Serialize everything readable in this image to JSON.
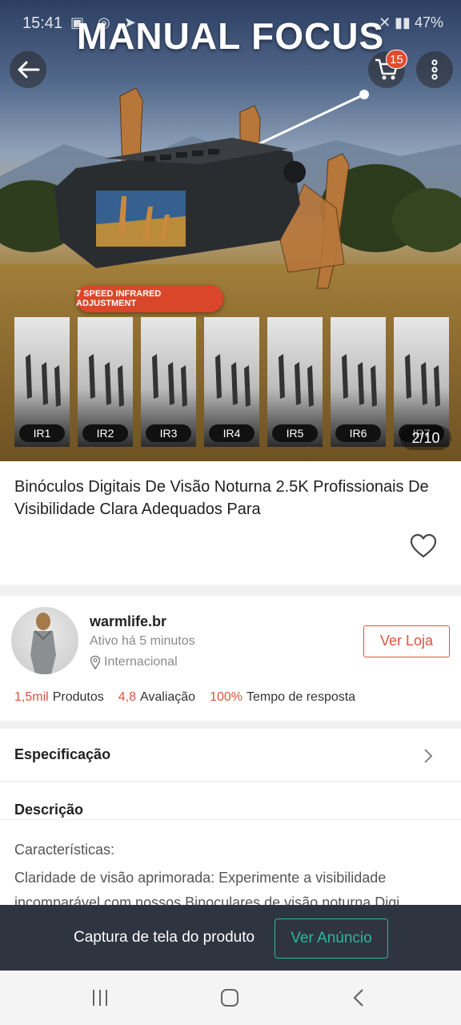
{
  "status_bar": {
    "time": "15:41",
    "battery": "47%"
  },
  "hero": {
    "overlay_title": "MANUAL FOCUS",
    "ir_caption": "7 SPEED INFRARED ADJUSTMENT",
    "ir_labels": [
      "IR1",
      "IR2",
      "IR3",
      "IR4",
      "IR5",
      "IR6",
      "IR7"
    ],
    "counter": "2/10",
    "cart_count": "15"
  },
  "product": {
    "title": "Binóculos Digitais De Visão Noturna 2.5K Profissionais De Visibilidade Clara Adequados Para"
  },
  "store": {
    "name": "warmlife.br",
    "active": "Ativo há 5 minutos",
    "location": "Internacional",
    "visit_label": "Ver Loja",
    "stats": [
      {
        "value": "1,5mil",
        "label": "Produtos"
      },
      {
        "value": "4,8",
        "label": "Avaliação"
      },
      {
        "value": "100%",
        "label": "Tempo de resposta"
      }
    ]
  },
  "spec": {
    "label": "Especificação"
  },
  "description": {
    "title": "Descrição",
    "subtitle": "Características:",
    "text": "Claridade de visão aprimorada: Experimente a visibilidade incomparável com nossos Binoculares de visão noturna Digi..."
  },
  "capture": {
    "text": "Captura de tela do produto",
    "button": "Ver Anúncio"
  },
  "colors": {
    "accent": "#e0533d",
    "teal": "#2fb69d",
    "overlay_bar": "#2e3440"
  }
}
